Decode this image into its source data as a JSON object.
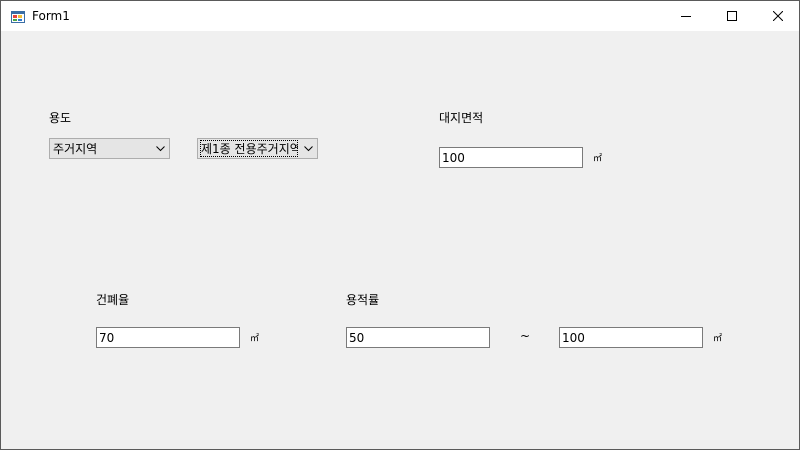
{
  "window": {
    "title": "Form1"
  },
  "site": {
    "usage_label": "용도"
  },
  "usage_zone": {
    "value": "주거지역"
  },
  "usage_district": {
    "value": "제1종 전용주거지역"
  },
  "land_area": {
    "label": "대지면적",
    "value": "100",
    "unit": "㎡"
  },
  "building_coverage": {
    "label": "건폐율",
    "value": "70",
    "unit": "㎡"
  },
  "floor_area_ratio": {
    "label": "용적률",
    "min_value": "50",
    "separator": "~",
    "max_value": "100",
    "unit": "㎡"
  },
  "icons": {
    "app": "windows-form-icon",
    "minimize": "minimize-icon",
    "maximize": "maximize-icon",
    "close": "close-icon",
    "dropdown": "chevron-down-icon"
  }
}
